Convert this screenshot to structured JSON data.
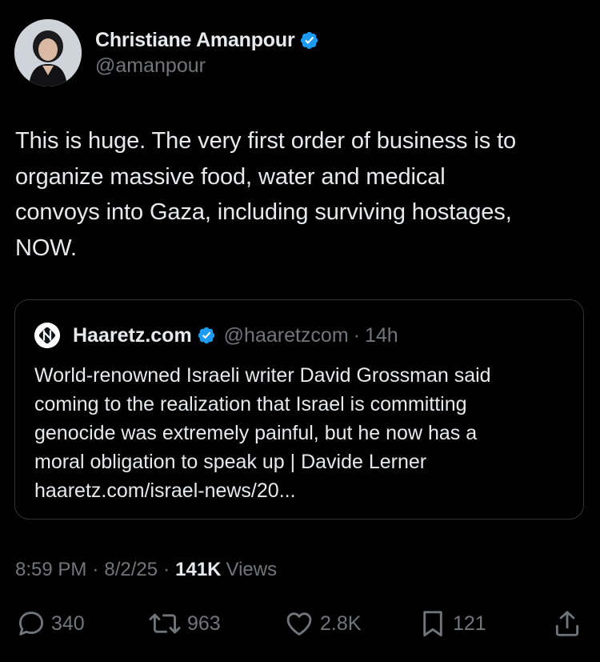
{
  "author": {
    "display_name": "Christiane Amanpour",
    "handle": "@amanpour",
    "verified": true
  },
  "tweet": {
    "text_lines": [
      "This is huge. The very first order of business is to",
      "organize massive food, water and medical",
      "convoys into Gaza, including surviving hostages,",
      "NOW."
    ]
  },
  "quote": {
    "display_name": "Haaretz.com",
    "handle": "@haaretzcom",
    "separator": "·",
    "time": "14h",
    "verified": true,
    "text_lines": [
      "World-renowned Israeli writer David Grossman said",
      "coming to the realization that Israel is committing",
      "genocide was extremely painful, but he now has a",
      "moral obligation to speak up | Davide Lerner",
      "haaretz.com/israel-news/20..."
    ]
  },
  "meta": {
    "time": "8:59 PM",
    "separator": "·",
    "date": "8/2/25",
    "views_count": "141K",
    "views_label": "Views"
  },
  "actions": {
    "replies": "340",
    "reposts": "963",
    "likes": "2.8K",
    "bookmarks": "121"
  },
  "colors": {
    "background": "#000000",
    "text": "#e7e9ea",
    "muted": "#71767b",
    "border": "#2f3336",
    "verified_blue": "#1d9bf0"
  },
  "icons": [
    "verified-badge-icon",
    "haaretz-logo-icon",
    "reply-icon",
    "repost-icon",
    "like-icon",
    "bookmark-icon",
    "share-icon"
  ]
}
